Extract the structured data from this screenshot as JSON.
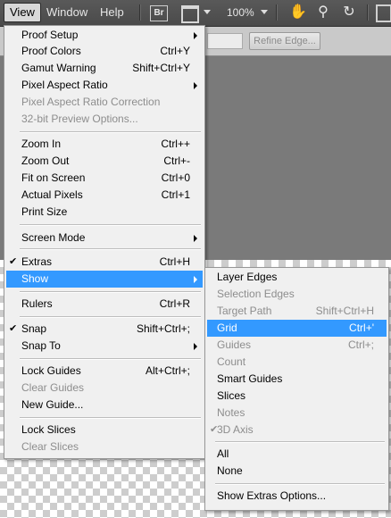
{
  "menubar": {
    "items": [
      "View",
      "Window",
      "Help"
    ],
    "br_label": "Br",
    "zoom": "100%"
  },
  "options": {
    "refine_edge": "Refine Edge..."
  },
  "view_menu": [
    {
      "label": "Proof Setup",
      "shortcut": "",
      "submenu": true,
      "disabled": false
    },
    {
      "label": "Proof Colors",
      "shortcut": "Ctrl+Y",
      "submenu": false,
      "disabled": false
    },
    {
      "label": "Gamut Warning",
      "shortcut": "Shift+Ctrl+Y",
      "submenu": false,
      "disabled": false
    },
    {
      "label": "Pixel Aspect Ratio",
      "shortcut": "",
      "submenu": true,
      "disabled": false
    },
    {
      "label": "Pixel Aspect Ratio Correction",
      "shortcut": "",
      "submenu": false,
      "disabled": true
    },
    {
      "label": "32-bit Preview Options...",
      "shortcut": "",
      "submenu": false,
      "disabled": true
    },
    {
      "label": "Zoom In",
      "shortcut": "Ctrl++",
      "submenu": false,
      "disabled": false
    },
    {
      "label": "Zoom Out",
      "shortcut": "Ctrl+-",
      "submenu": false,
      "disabled": false
    },
    {
      "label": "Fit on Screen",
      "shortcut": "Ctrl+0",
      "submenu": false,
      "disabled": false
    },
    {
      "label": "Actual Pixels",
      "shortcut": "Ctrl+1",
      "submenu": false,
      "disabled": false
    },
    {
      "label": "Print Size",
      "shortcut": "",
      "submenu": false,
      "disabled": false
    },
    {
      "label": "Screen Mode",
      "shortcut": "",
      "submenu": true,
      "disabled": false
    },
    {
      "label": "Extras",
      "shortcut": "Ctrl+H",
      "submenu": false,
      "disabled": false,
      "checked": true
    },
    {
      "label": "Show",
      "shortcut": "",
      "submenu": true,
      "disabled": false,
      "highlighted": true
    },
    {
      "label": "Rulers",
      "shortcut": "Ctrl+R",
      "submenu": false,
      "disabled": false
    },
    {
      "label": "Snap",
      "shortcut": "Shift+Ctrl+;",
      "submenu": false,
      "disabled": false,
      "checked": true
    },
    {
      "label": "Snap To",
      "shortcut": "",
      "submenu": true,
      "disabled": false
    },
    {
      "label": "Lock Guides",
      "shortcut": "Alt+Ctrl+;",
      "submenu": false,
      "disabled": false
    },
    {
      "label": "Clear Guides",
      "shortcut": "",
      "submenu": false,
      "disabled": true
    },
    {
      "label": "New Guide...",
      "shortcut": "",
      "submenu": false,
      "disabled": false
    },
    {
      "label": "Lock Slices",
      "shortcut": "",
      "submenu": false,
      "disabled": false
    },
    {
      "label": "Clear Slices",
      "shortcut": "",
      "submenu": false,
      "disabled": true
    }
  ],
  "show_menu": [
    {
      "label": "Layer Edges",
      "shortcut": "",
      "disabled": false
    },
    {
      "label": "Selection Edges",
      "shortcut": "",
      "disabled": true
    },
    {
      "label": "Target Path",
      "shortcut": "Shift+Ctrl+H",
      "disabled": true
    },
    {
      "label": "Grid",
      "shortcut": "Ctrl+'",
      "disabled": false,
      "highlighted": true
    },
    {
      "label": "Guides",
      "shortcut": "Ctrl+;",
      "disabled": true
    },
    {
      "label": "Count",
      "shortcut": "",
      "disabled": true
    },
    {
      "label": "Smart Guides",
      "shortcut": "",
      "disabled": false
    },
    {
      "label": "Slices",
      "shortcut": "",
      "disabled": false
    },
    {
      "label": "Notes",
      "shortcut": "",
      "disabled": true
    },
    {
      "label": "3D Axis",
      "shortcut": "",
      "disabled": true,
      "checked": true
    },
    {
      "label": "All",
      "shortcut": "",
      "disabled": false
    },
    {
      "label": "None",
      "shortcut": "",
      "disabled": false
    },
    {
      "label": "Show Extras Options...",
      "shortcut": "",
      "disabled": false
    }
  ],
  "colors": {
    "highlight": "#3399ff",
    "disabled_text": "#8d8d8d"
  }
}
